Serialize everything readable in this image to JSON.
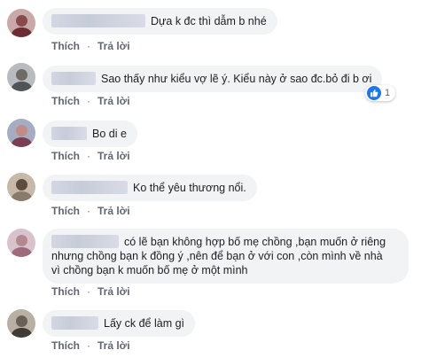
{
  "comments": [
    {
      "text": "Dựa k đc thì dẫm b nhé"
    },
    {
      "text": "Sao thấy như kiểu vợ lẽ ý. Kiểu này ở sao đc.bỏ đi b ơi",
      "reaction": {
        "icon": "thumbs-up-icon",
        "count": "1"
      }
    },
    {
      "text": "Bo di e"
    },
    {
      "text": "Ko thể yêu thương nổi."
    },
    {
      "text_line1": "có lẽ bạn không hợp bố mẹ chồng ,bạn muốn ở riêng",
      "text_line2": "nhưng chồng bạn k đồng ý ,nên để bạn ở với con ,còn mình về nhà",
      "text_line3": "vì chồng bạn k muốn bố mẹ ở một mình"
    },
    {
      "text": "Lấy ck để làm gì"
    }
  ],
  "actions": {
    "like": "Thích",
    "reply": "Trả lời",
    "separator": "·"
  },
  "colors": {
    "bubble": "#f2f3f5",
    "action_text": "#606770",
    "like_blue": "#1877f2"
  }
}
